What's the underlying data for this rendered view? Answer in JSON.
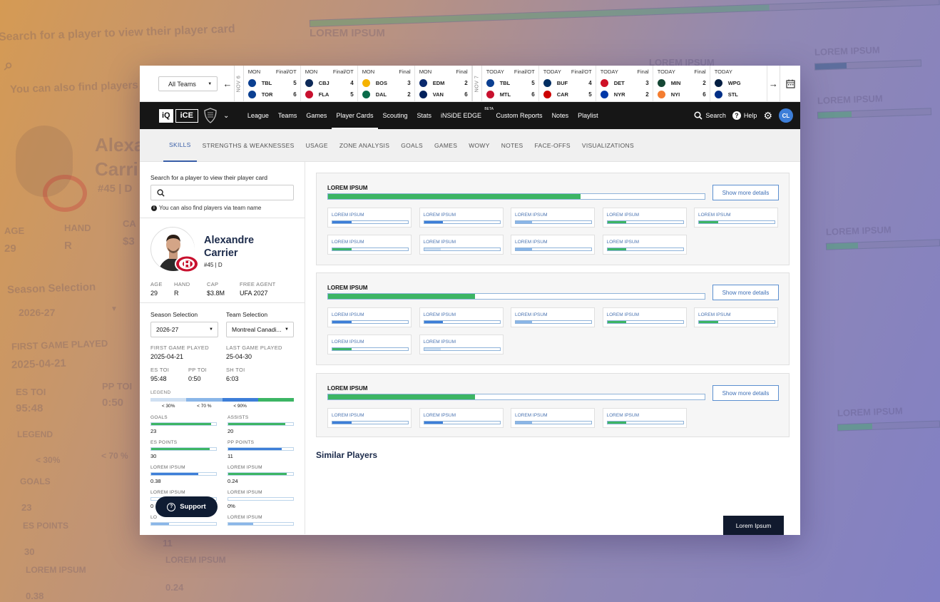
{
  "background": {
    "search_label": "Search for a player to view their player card",
    "note": "You can also find players",
    "first_name": "Alexa",
    "last_name": "Carri",
    "number": "#45 | D",
    "age_label": "AGE",
    "age_value": "29",
    "hand_label": "HAND",
    "hand_value": "R",
    "cap_label": "CA",
    "cap_value": "$3",
    "season_label": "Season Selection",
    "season_value": "2026-27",
    "first_game_label": "FIRST GAME PLAYED",
    "first_game_value": "2025-04-21",
    "es_toi_label": "ES TOI",
    "es_toi_value": "95:48",
    "pp_toi_label": "PP TOI",
    "pp_toi_value": "0:50",
    "legend_label": "LEGEND",
    "legend_30": "< 30%",
    "legend_70": "< 70 %",
    "goals_label": "GOALS",
    "goals_value": "23",
    "es_points_label": "ES POINTS",
    "es_points_value": "30",
    "lorem_label": "LOREM IPSUM",
    "lorem_value": "0.38",
    "right_val_11": "11",
    "right_val_024": "0.24",
    "cards": [
      "LOREM IPSUM",
      "LOREM IPSUM",
      "LOREM IPSUM",
      "LOREM IPSUM",
      "LOREM IPSUM",
      "LOREM IPSUM",
      "LOREM IPSUM"
    ]
  },
  "gamebar": {
    "team_filter": "All Teams",
    "day1_label": "NOV 6",
    "day2_label": "NOV 7",
    "games": [
      {
        "day": "MON",
        "status": "Final/OT",
        "away": "TBL",
        "away_score": "5",
        "home": "TOR",
        "home_score": "6",
        "away_color": "#0b3f91",
        "home_color": "#0b3f91"
      },
      {
        "day": "MON",
        "status": "Final/OT",
        "away": "CBJ",
        "away_score": "4",
        "home": "FLA",
        "home_score": "5",
        "away_color": "#0d2a58",
        "home_color": "#c8102e"
      },
      {
        "day": "MON",
        "status": "Final",
        "away": "BOS",
        "away_score": "3",
        "home": "DAL",
        "home_score": "2",
        "away_color": "#f5b300",
        "home_color": "#0a6b4a"
      },
      {
        "day": "MON",
        "status": "Final",
        "away": "EDM",
        "away_score": "2",
        "home": "VAN",
        "home_score": "6",
        "away_color": "#0b2a6e",
        "home_color": "#00205b"
      },
      {
        "day": "TODAY",
        "status": "Final/OT",
        "away": "TBL",
        "away_score": "5",
        "home": "MTL",
        "home_score": "6",
        "away_color": "#0b3f91",
        "home_color": "#c8102e"
      },
      {
        "day": "TODAY",
        "status": "Final/OT",
        "away": "BUF",
        "away_score": "4",
        "home": "CAR",
        "home_score": "5",
        "away_color": "#002e62",
        "home_color": "#cc0000"
      },
      {
        "day": "TODAY",
        "status": "Final",
        "away": "DET",
        "away_score": "3",
        "home": "NYR",
        "home_score": "2",
        "away_color": "#ce1126",
        "home_color": "#0038a8"
      },
      {
        "day": "TODAY",
        "status": "Final",
        "away": "MIN",
        "away_score": "2",
        "home": "NYI",
        "home_score": "6",
        "away_color": "#154734",
        "home_color": "#f47d30"
      },
      {
        "day": "TODAY",
        "status": "",
        "away": "WPG",
        "away_score": "",
        "home": "STL",
        "home_score": "",
        "away_color": "#041e42",
        "home_color": "#002f87"
      }
    ]
  },
  "nav": {
    "logo_iq": "iQ",
    "logo_ice": "iCE",
    "items": [
      "League",
      "Teams",
      "Games",
      "Player Cards",
      "Scouting",
      "Stats",
      "iNSiDE EDGE",
      "Custom Reports",
      "Notes",
      "Playlist"
    ],
    "beta": "BETA",
    "search": "Search",
    "help": "Help",
    "avatar": "CL"
  },
  "tabs": [
    "SKILLS",
    "STRENGTHS & WEAKNESSES",
    "USAGE",
    "ZONE ANALYSIS",
    "GOALS",
    "GAMES",
    "WOWY",
    "NOTES",
    "FACE-OFFS",
    "VISUALIZATIONS"
  ],
  "player": {
    "search_label": "Search for a player to view their player card",
    "search_placeholder": "",
    "team_note": "You can also find players via team name",
    "first_name": "Alexandre",
    "last_name": "Carrier",
    "number_pos": "#45 | D",
    "age_label": "AGE",
    "age": "29",
    "hand_label": "HAND",
    "hand": "R",
    "cap_label": "CAP",
    "cap": "$3.8M",
    "fa_label": "FREE AGENT",
    "fa": "UFA 2027",
    "season_label": "Season Selection",
    "season": "2026-27",
    "team_label": "Team Selection",
    "team": "Montreal Canadi...",
    "first_game_label": "FIRST GAME PLAYED",
    "first_game": "2025-04-21",
    "last_game_label": "LAST GAME PLAYED",
    "last_game": "25-04-30",
    "es_toi_label": "ES TOI",
    "es_toi": "95:48",
    "pp_toi_label": "PP TOI",
    "pp_toi": "0:50",
    "sh_toi_label": "SH TOI",
    "sh_toi": "6:03",
    "legend_label": "LEGEND",
    "legend_items": [
      "< 30%",
      "< 70 %",
      "< 90%"
    ],
    "legend_colors": [
      "#cfe0f2",
      "#8ab6e8",
      "#3d7ed8",
      "#3cb564"
    ],
    "metrics": [
      {
        "label": "GOALS",
        "value": "23",
        "fill": 0.92,
        "color": "#3cb564"
      },
      {
        "label": "ASSISTS",
        "value": "20",
        "fill": 0.88,
        "color": "#3cb564"
      },
      {
        "label": "ES POINTS",
        "value": "30",
        "fill": 0.9,
        "color": "#3cb564"
      },
      {
        "label": "PP POINTS",
        "value": "11",
        "fill": 0.82,
        "color": "#3d7ed8"
      },
      {
        "label": "LOREM IPSUM",
        "value": "0.38",
        "fill": 0.72,
        "color": "#3d7ed8"
      },
      {
        "label": "LOREM IPSUM",
        "value": "0.24",
        "fill": 0.9,
        "color": "#3cb564"
      },
      {
        "label": "LOREM IPSUM",
        "value": "0",
        "fill": 0.0,
        "color": "#8ab6e8"
      },
      {
        "label": "LOREM IPSUM",
        "value": "0%",
        "fill": 0.0,
        "color": "#8ab6e8"
      },
      {
        "label": "LO",
        "value": "",
        "fill": 0.28,
        "color": "#8ab6e8"
      },
      {
        "label": "LOREM IPSUM",
        "value": "",
        "fill": 0.38,
        "color": "#8ab6e8"
      }
    ],
    "support": "Support"
  },
  "skills": {
    "show_more": "Show more details",
    "cards": [
      {
        "title": "LOREM IPSUM",
        "fill": 0.67,
        "items": [
          {
            "label": "LOREM IPSUM",
            "fill": 0.25,
            "color": "#3d7ed8"
          },
          {
            "label": "LOREM IPSUM",
            "fill": 0.25,
            "color": "#3d7ed8"
          },
          {
            "label": "LOREM IPSUM",
            "fill": 0.22,
            "color": "#8ab6e8"
          },
          {
            "label": "LOREM IPSUM",
            "fill": 0.25,
            "color": "#3cb564"
          },
          {
            "label": "LOREM IPSUM",
            "fill": 0.25,
            "color": "#3cb564"
          },
          {
            "label": "LOREM IPSUM",
            "fill": 0.25,
            "color": "#3cb564"
          },
          {
            "label": "LOREM IPSUM",
            "fill": 0.22,
            "color": "#cfe0f2"
          },
          {
            "label": "LOREM IPSUM",
            "fill": 0.22,
            "color": "#8ab6e8"
          },
          {
            "label": "LOREM IPSUM",
            "fill": 0.25,
            "color": "#3cb564"
          }
        ]
      },
      {
        "title": "LOREM IPSUM",
        "fill": 0.39,
        "items": [
          {
            "label": "LOREM IPSUM",
            "fill": 0.25,
            "color": "#3d7ed8"
          },
          {
            "label": "LOREM IPSUM",
            "fill": 0.25,
            "color": "#3d7ed8"
          },
          {
            "label": "LOREM IPSUM",
            "fill": 0.22,
            "color": "#8ab6e8"
          },
          {
            "label": "LOREM IPSUM",
            "fill": 0.25,
            "color": "#3cb564"
          },
          {
            "label": "LOREM IPSUM",
            "fill": 0.25,
            "color": "#3cb564"
          },
          {
            "label": "LOREM IPSUM",
            "fill": 0.25,
            "color": "#3cb564"
          },
          {
            "label": "LOREM IPSUM",
            "fill": 0.22,
            "color": "#cfe0f2"
          }
        ]
      },
      {
        "title": "LOREM IPSUM",
        "fill": 0.39,
        "items": [
          {
            "label": "LOREM IPSUM",
            "fill": 0.25,
            "color": "#3d7ed8"
          },
          {
            "label": "LOREM IPSUM",
            "fill": 0.25,
            "color": "#3d7ed8"
          },
          {
            "label": "LOREM IPSUM",
            "fill": 0.22,
            "color": "#8ab6e8"
          },
          {
            "label": "LOREM IPSUM",
            "fill": 0.25,
            "color": "#3cb564"
          }
        ]
      }
    ],
    "similar_title": "Similar Players",
    "lorem_button": "Lorem Ipsum"
  }
}
